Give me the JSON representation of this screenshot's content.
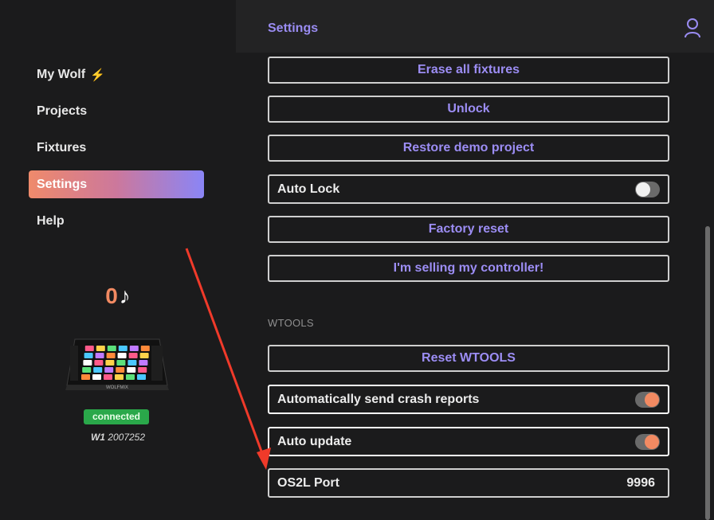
{
  "sidebar": {
    "items": [
      {
        "label": "My Wolf",
        "badge": "⚡"
      },
      {
        "label": "Projects"
      },
      {
        "label": "Fixtures"
      },
      {
        "label": "Settings",
        "active": true
      },
      {
        "label": "Help"
      }
    ],
    "counter": {
      "value": "0",
      "symbol": "♪"
    },
    "device_logo_text": "WOLFMIX",
    "status": "connected",
    "serial_model": "W1",
    "serial_number": "2007252"
  },
  "header": {
    "title": "Settings",
    "user_icon": "user-icon"
  },
  "settings": {
    "erase_all_fixtures": "Erase all fixtures",
    "unlock": "Unlock",
    "restore_demo_project": "Restore demo project",
    "auto_lock": {
      "label": "Auto Lock",
      "enabled": false
    },
    "factory_reset": "Factory reset",
    "selling_controller": "I'm selling my controller!",
    "section_wtools": "WTOOLS",
    "reset_wtools": "Reset WTOOLS",
    "crash_reports": {
      "label": "Automatically send crash reports",
      "enabled": true
    },
    "auto_update": {
      "label": "Auto update",
      "enabled": true
    },
    "os2l_port": {
      "label": "OS2L Port",
      "value": "9996"
    }
  },
  "colors": {
    "accent_purple": "#9c8df4",
    "accent_orange": "#f28a62",
    "status_green": "#2aa84a",
    "annotation_red": "#f03a2a"
  }
}
